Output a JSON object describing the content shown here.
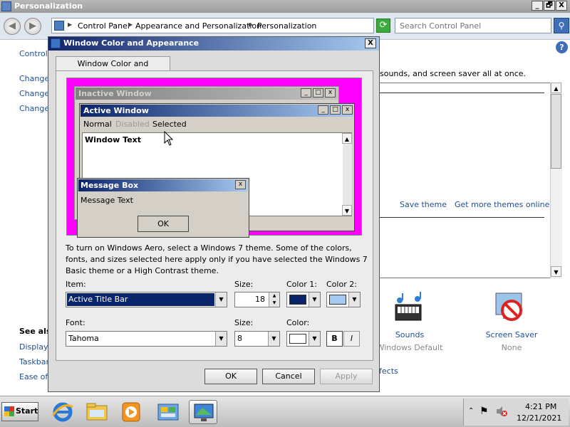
{
  "personalization": {
    "title": "Personalization",
    "caption_buttons": {
      "minimize": "_",
      "restore": "🗗",
      "close": "X"
    },
    "breadcrumbs": [
      "Control Panel",
      "Appearance and Personalization",
      "Personalization"
    ],
    "search_placeholder": "Search Control Panel",
    "left_links": [
      "Control",
      "Change",
      "Change",
      "Change"
    ],
    "subtitle": "sounds, and screen saver all at once.",
    "save_theme": "Save theme",
    "more_themes": "Get more themes online",
    "effects": "fects",
    "see_also": "See als",
    "see_also_links": [
      "Display",
      "Taskbar",
      "Ease of"
    ],
    "sounds": {
      "label": "Sounds",
      "value": "Windows Default"
    },
    "screen_saver": {
      "label": "Screen Saver",
      "value": "None"
    }
  },
  "dialog": {
    "title": "Window Color and Appearance",
    "tab": "Window Color and Appearance",
    "preview": {
      "inactive_title": "Inactive Window",
      "active_title": "Active Window",
      "menu": [
        "Normal",
        "Disabled",
        "Selected"
      ],
      "window_text": "Window Text",
      "msgbox_title": "Message Box",
      "msgbox_text": "Message Text",
      "msgbox_ok": "OK"
    },
    "aero_text": "To turn on Windows Aero, select a Windows 7 theme.  Some of the colors, fonts, and sizes selected here apply only if you have selected the Windows 7 Basic theme or a High Contrast theme.",
    "labels": {
      "item": "Item:",
      "size": "Size:",
      "color1": "Color 1:",
      "color2": "Color 2:",
      "font": "Font:",
      "size2": "Size:",
      "color": "Color:"
    },
    "item_value": "Active Title Bar",
    "item_size": "18",
    "color1": "#0a246a",
    "color2": "#a6caf0",
    "font_value": "Tahoma",
    "font_size": "8",
    "font_color": "#ffffff",
    "bold": "B",
    "italic": "I",
    "buttons": {
      "ok": "OK",
      "cancel": "Cancel",
      "apply": "Apply"
    }
  },
  "taskbar": {
    "start": "Start",
    "time": "4:21 PM",
    "date": "12/21/2021"
  }
}
